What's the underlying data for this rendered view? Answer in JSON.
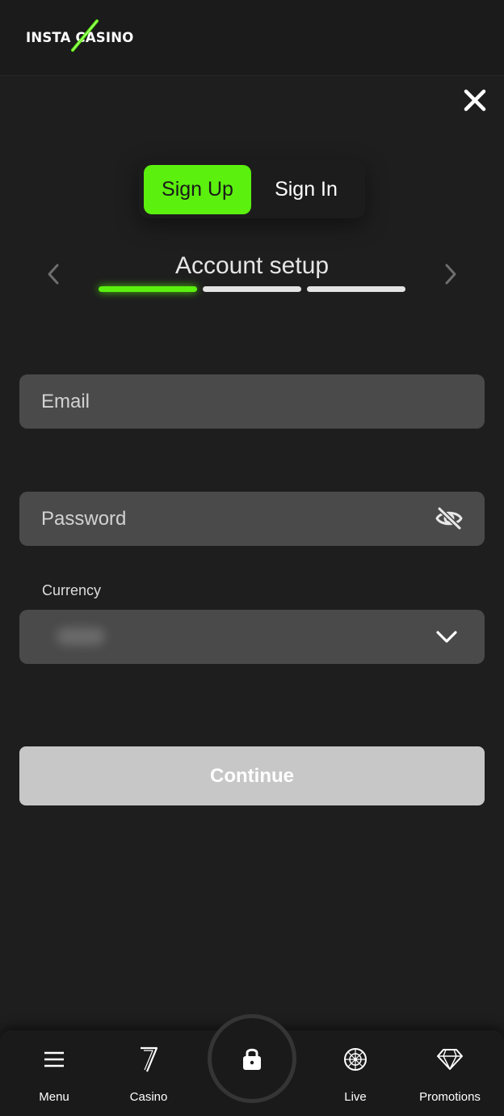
{
  "header": {
    "logo_text": "INSTA CASINO",
    "accent_color": "#5bf00e"
  },
  "icons": {
    "close": "close-icon",
    "eye": "eye-slash-icon",
    "chevron": "chevron-down-icon",
    "lock": "lock-icon"
  },
  "tabs": {
    "signup_label": "Sign Up",
    "signin_label": "Sign In",
    "active": "Sign Up"
  },
  "step": {
    "title": "Account setup",
    "current": 1,
    "total": 3
  },
  "form": {
    "email_placeholder": "Email",
    "password_placeholder": "Password",
    "currency_label": "Currency",
    "continue_label": "Continue"
  },
  "nav": {
    "menu_label": "Menu",
    "casino_label": "Casino",
    "live_label": "Live",
    "promotions_label": "Promotions"
  }
}
